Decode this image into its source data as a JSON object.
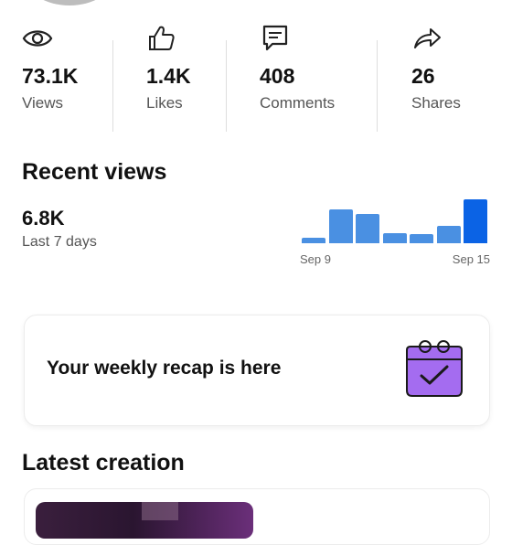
{
  "stats": [
    {
      "icon": "eye-icon",
      "value": "73.1K",
      "label": "Views"
    },
    {
      "icon": "thumbs-up-icon",
      "value": "1.4K",
      "label": "Likes"
    },
    {
      "icon": "comment-icon",
      "value": "408",
      "label": "Comments"
    },
    {
      "icon": "share-icon",
      "value": "26",
      "label": "Shares"
    }
  ],
  "recent_views": {
    "title": "Recent views",
    "value": "6.8K",
    "period": "Last 7 days",
    "start_label": "Sep 9",
    "end_label": "Sep 15",
    "bar_levels": [
      0.12,
      0.78,
      0.66,
      0.22,
      0.2,
      0.4,
      1.0
    ],
    "bar_color": "#4a90e2",
    "highlight_color": "#0b63e5"
  },
  "recap": {
    "text": "Your weekly recap is here",
    "art": "calendar-check-icon",
    "art_color": "#a46cf0"
  },
  "latest_creation": {
    "title": "Latest creation"
  }
}
